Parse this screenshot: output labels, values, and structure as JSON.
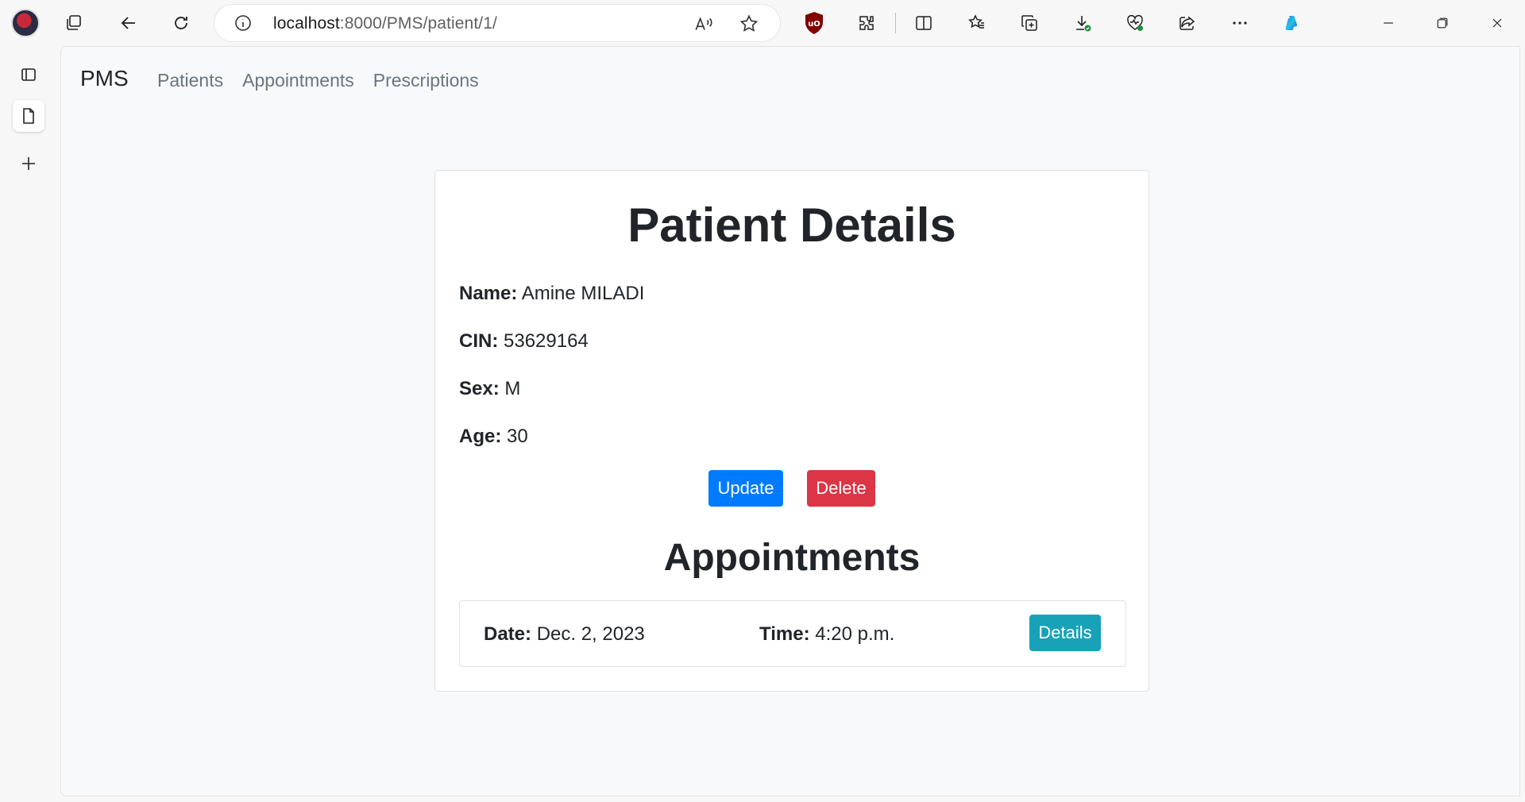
{
  "browser": {
    "url_host": "localhost",
    "url_path": ":8000/PMS/patient/1/",
    "icons": [
      "profile-avatar",
      "tabs-icon",
      "back-icon",
      "refresh-icon",
      "info-icon",
      "read-aloud-icon",
      "favorite-star-icon",
      "ublock-icon",
      "extensions-icon",
      "split-screen-icon",
      "favorites-icon",
      "collections-icon",
      "downloads-icon",
      "browser-health-icon",
      "share-icon",
      "more-icon",
      "copilot-icon",
      "minimize-icon",
      "restore-icon",
      "close-icon"
    ]
  },
  "sidebar": {
    "icons": [
      "vertical-tabs-icon",
      "page-tab-icon",
      "new-tab-icon"
    ]
  },
  "navbar": {
    "brand": "PMS",
    "links": [
      "Patients",
      "Appointments",
      "Prescriptions"
    ]
  },
  "patient": {
    "title": "Patient Details",
    "name_label": "Name:",
    "name": "Amine MILADI",
    "cin_label": "CIN:",
    "cin": "53629164",
    "sex_label": "Sex:",
    "sex": "M",
    "age_label": "Age:",
    "age": "30",
    "update_label": "Update",
    "delete_label": "Delete"
  },
  "appointments": {
    "title": "Appointments",
    "items": [
      {
        "date_label": "Date:",
        "date": "Dec. 2, 2023",
        "time_label": "Time:",
        "time": "4:20 p.m.",
        "details_label": "Details"
      }
    ]
  },
  "colors": {
    "primary": "#007bff",
    "danger": "#dc3545",
    "info": "#17a2b8"
  }
}
